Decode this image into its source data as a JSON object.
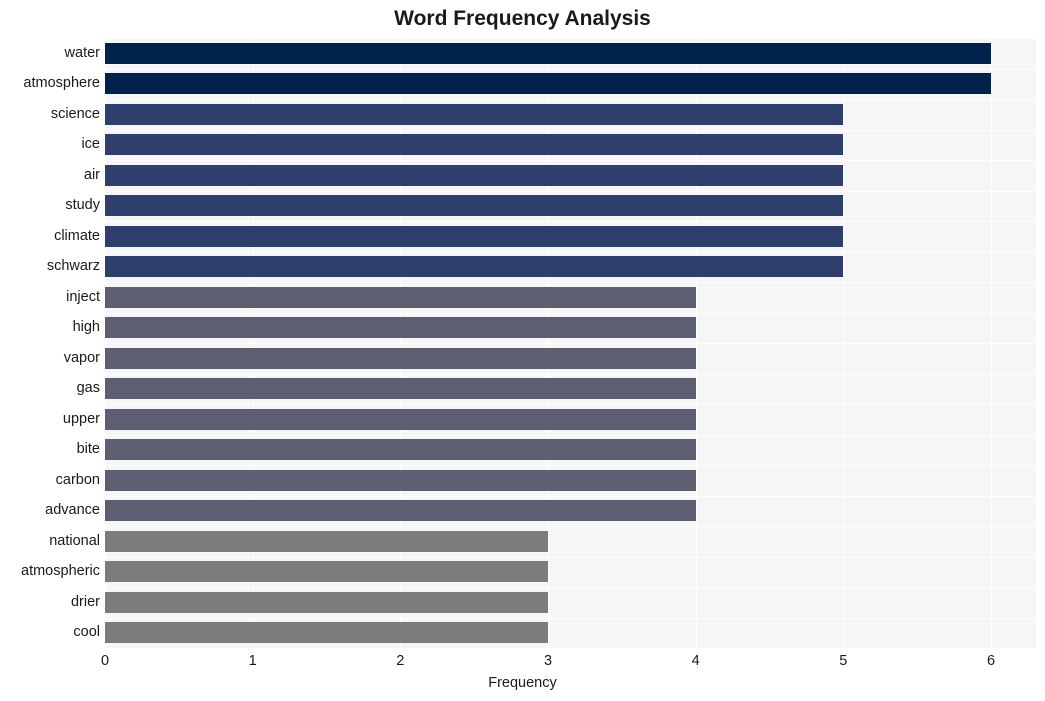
{
  "chart_data": {
    "type": "bar",
    "orientation": "horizontal",
    "title": "Word Frequency Analysis",
    "xlabel": "Frequency",
    "ylabel": "",
    "categories": [
      "water",
      "atmosphere",
      "science",
      "ice",
      "air",
      "study",
      "climate",
      "schwarz",
      "inject",
      "high",
      "vapor",
      "gas",
      "upper",
      "bite",
      "carbon",
      "advance",
      "national",
      "atmospheric",
      "drier",
      "cool"
    ],
    "values": [
      6,
      6,
      5,
      5,
      5,
      5,
      5,
      5,
      4,
      4,
      4,
      4,
      4,
      4,
      4,
      4,
      3,
      3,
      3,
      3
    ],
    "bar_colors": [
      "#00234d",
      "#00234d",
      "#2e3f6d",
      "#2e3f6d",
      "#2e3f6d",
      "#2e3f6d",
      "#2e3f6d",
      "#2e3f6d",
      "#5b5f71",
      "#5b5f71",
      "#5b5f71",
      "#5b5f71",
      "#5b5f71",
      "#5b5f71",
      "#5b5f71",
      "#5b5f71",
      "#7c7c7c",
      "#7c7c7c",
      "#7c7c7c",
      "#7c7c7c"
    ],
    "xlim": [
      0,
      6
    ],
    "xticks": [
      0,
      1,
      2,
      3,
      4,
      5,
      6
    ],
    "xtick_labels": [
      "0",
      "1",
      "2",
      "3",
      "4",
      "5",
      "6"
    ],
    "grid": true,
    "grid_color": "#ffffff",
    "plot_background": "#f6f6f7",
    "figure_background": "#ffffff",
    "legend": null
  }
}
